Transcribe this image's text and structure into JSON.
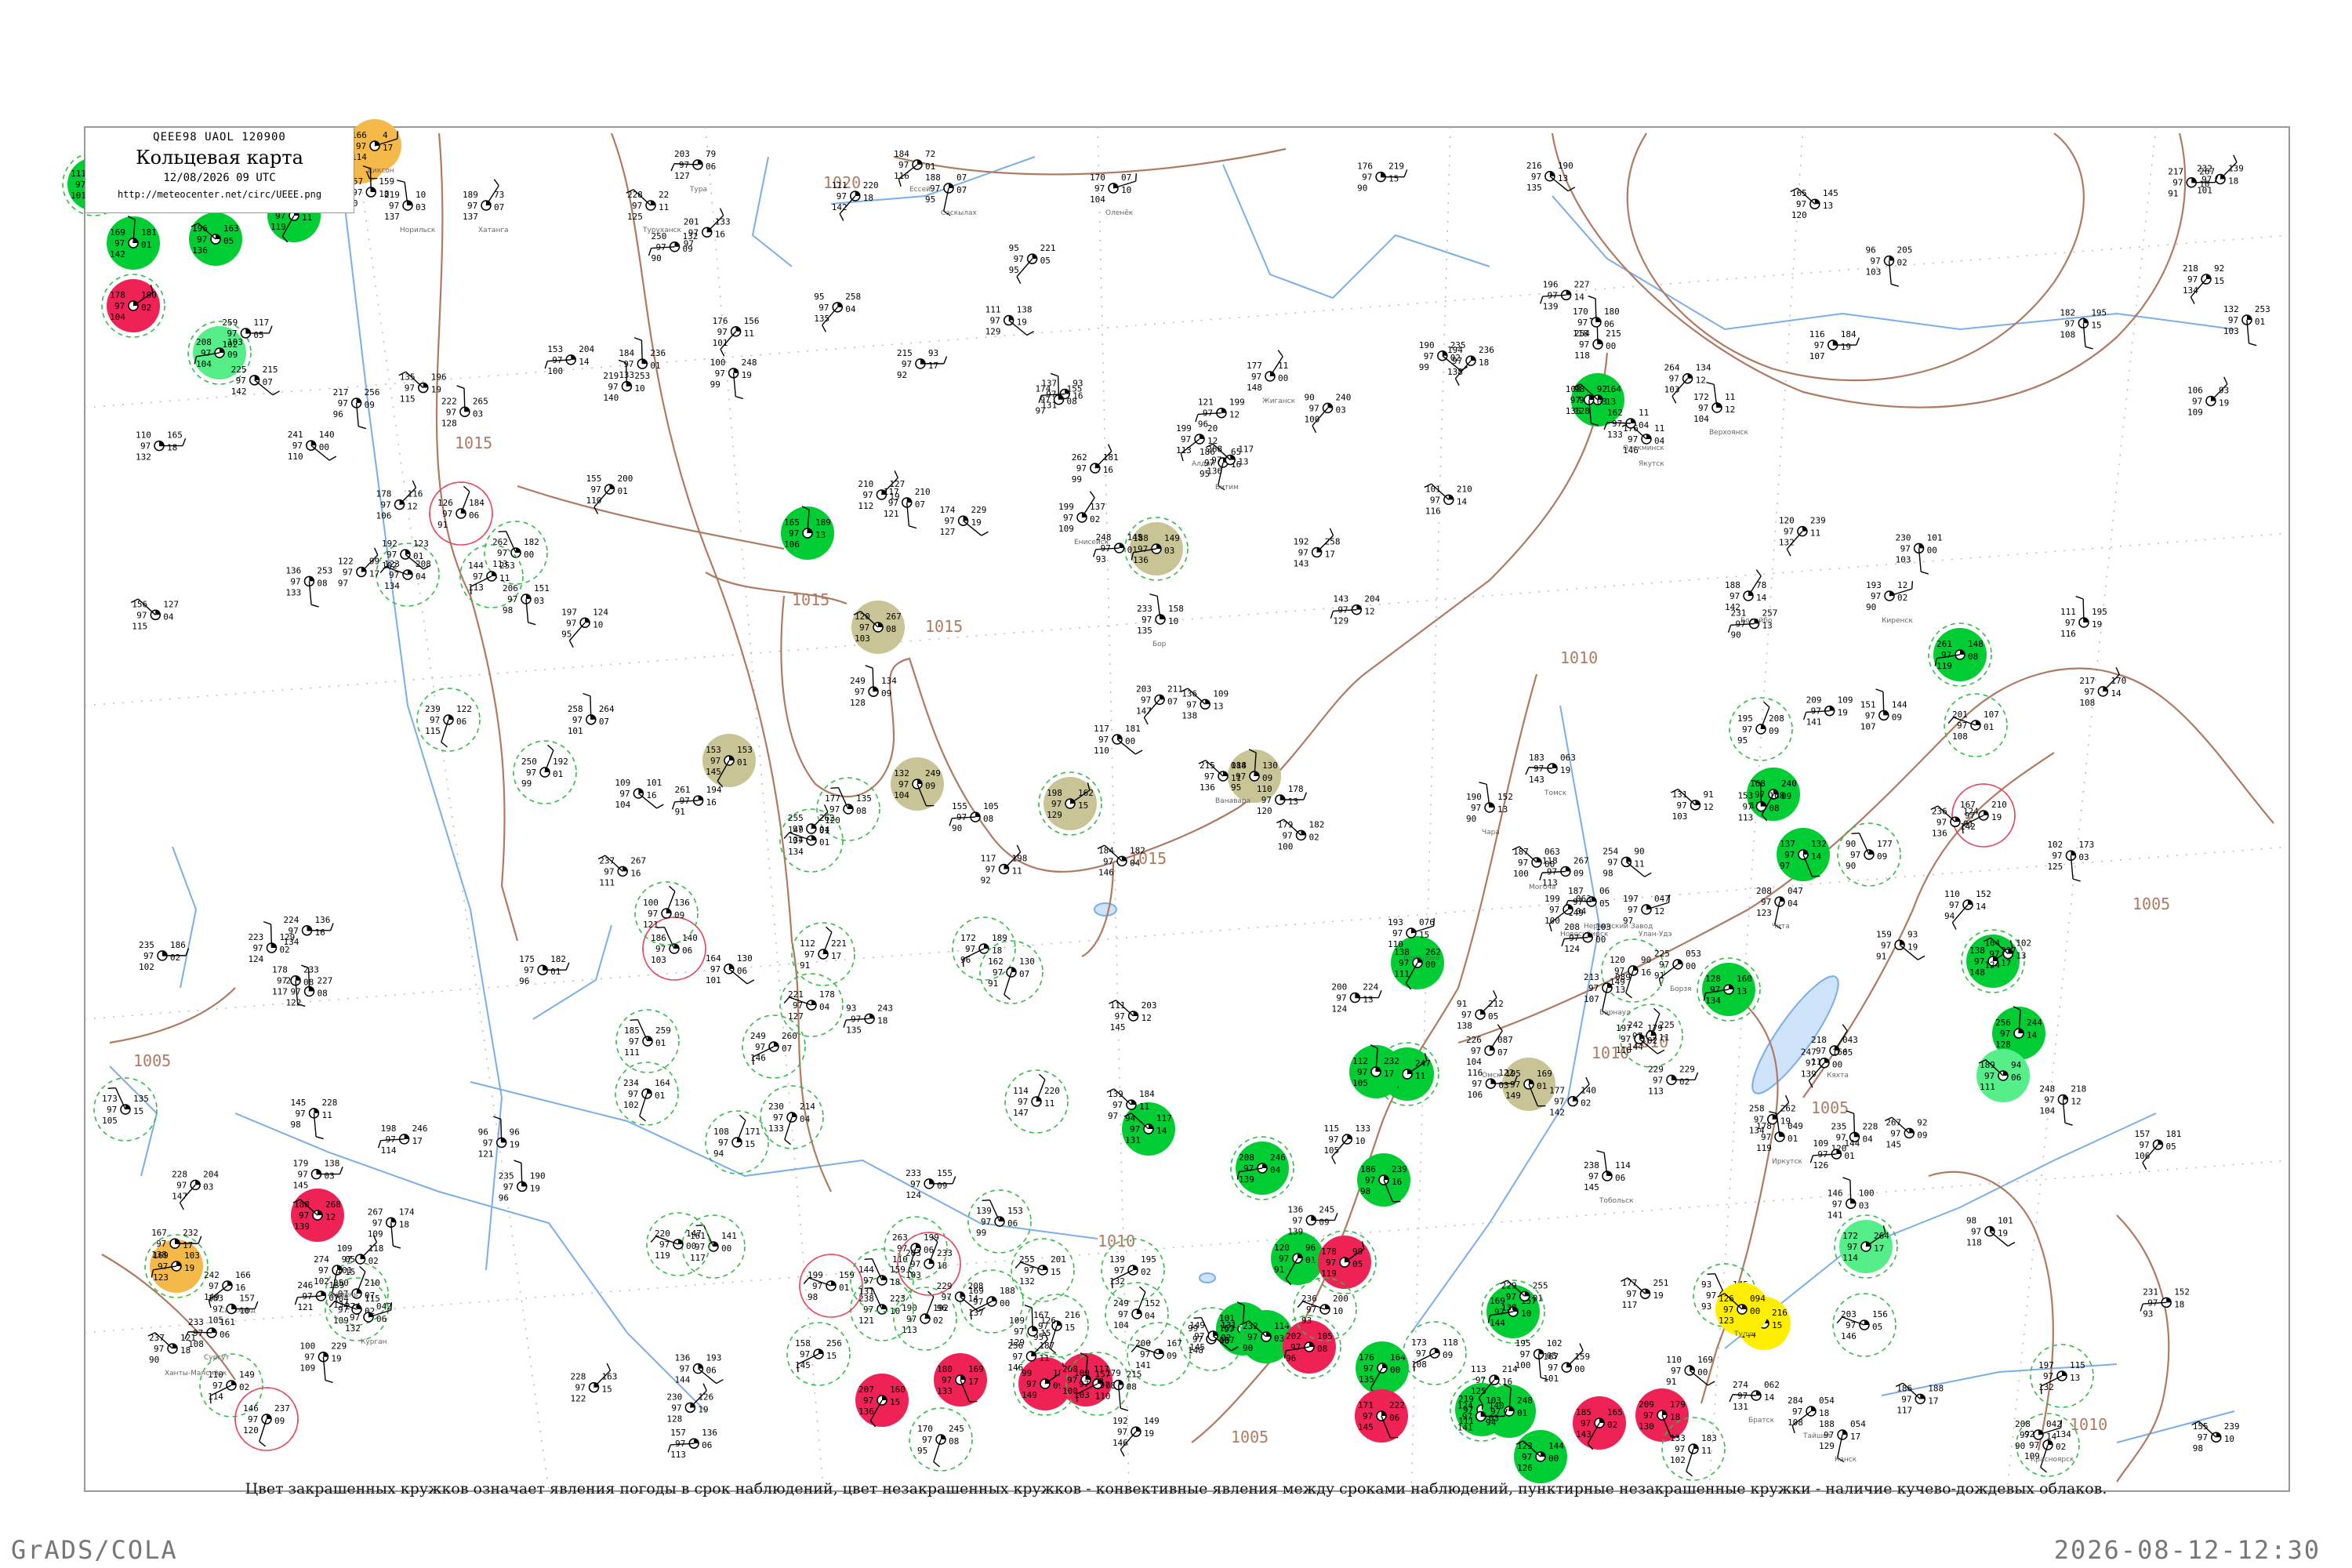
{
  "header": {
    "code": "QEEE98  UAOL  120900",
    "title": "Кольцевая карта",
    "time": "12/08/2026 09 UTC",
    "url": "http://meteocenter.net/circ/UEEE.png"
  },
  "caption": "Цвет закрашенных кружков означает явления погоды в срок наблюдений, цвет незакрашенных кружков - конвективные явления между сроками наблюдений, пунктирные незакрашенные кружки - наличие кучево-дождевых облаков.",
  "footer": {
    "software": "GrADS/COLA",
    "timestamp": "2026-08-12-12:30"
  },
  "colors": {
    "rain": "#00cc33",
    "thunder": "#ee2255",
    "fog": "#c8c496",
    "shower_light": "#55ee88",
    "haze": "#f5b94a",
    "smoke": "#ffee00",
    "isobar": "#b07a60",
    "river": "#7aaee8"
  },
  "isobar_labels": [
    "1020",
    "1015",
    "1015",
    "1015",
    "1015",
    "1010",
    "1010",
    "1010",
    "1010",
    "1005",
    "1005",
    "1005",
    "1005",
    "1010"
  ],
  "stations": [
    {
      "name": "Диксон",
      "p": "166",
      "t": "4",
      "c": "haze"
    },
    {
      "name": "Хатанга",
      "p": "189",
      "t": "73"
    },
    {
      "name": "Норильск",
      "p": "219",
      "t": "10"
    },
    {
      "name": "Туруханск",
      "p": "228",
      "t": "22"
    },
    {
      "name": "Тура",
      "p": "203",
      "t": "79"
    },
    {
      "name": "Ессей",
      "p": "184",
      "t": "72"
    },
    {
      "name": "Саскылах",
      "p": "188",
      "t": "07"
    },
    {
      "name": "Оленёк",
      "p": "170",
      "t": "07"
    },
    {
      "name": "Жиганск",
      "p": "177",
      "t": "11"
    },
    {
      "name": "Верхоянск",
      "p": "172",
      "t": "11"
    },
    {
      "name": "Якутск",
      "p": "176",
      "t": "11"
    },
    {
      "name": "Олекминск",
      "p": "162",
      "t": "11"
    },
    {
      "name": "Алдан",
      "p": "199",
      "t": "20"
    },
    {
      "name": "Витим",
      "p": "186",
      "t": "65"
    },
    {
      "name": "Киренск",
      "p": "193",
      "t": "12"
    },
    {
      "name": "Бодайбо",
      "p": "188",
      "t": "78"
    },
    {
      "name": "Чара",
      "p": "190",
      "t": "152"
    },
    {
      "name": "Могоча",
      "p": "187",
      "t": "063"
    },
    {
      "name": "Нерчинский Завод",
      "p": "187",
      "t": "06"
    },
    {
      "name": "Борзя",
      "p": "225",
      "t": "053"
    },
    {
      "name": "Чита",
      "p": "208",
      "t": "047"
    },
    {
      "name": "Улан-Удэ",
      "p": "197",
      "t": "047"
    },
    {
      "name": "Кяхта",
      "p": "218",
      "t": "043"
    },
    {
      "name": "Иркутск",
      "p": "178",
      "t": "049"
    },
    {
      "name": "Тулун",
      "p": "126",
      "t": "094",
      "c": "smoke"
    },
    {
      "name": "Братск",
      "p": "274",
      "t": "062"
    },
    {
      "name": "Тайшет",
      "p": "284",
      "t": "054"
    },
    {
      "name": "Канск",
      "p": "188",
      "t": "054"
    },
    {
      "name": "Красноярск",
      "p": "208",
      "t": "042"
    },
    {
      "name": "Енисейск",
      "p": "199",
      "t": "137"
    },
    {
      "name": "Бор",
      "p": "233",
      "t": "158"
    },
    {
      "name": "Ванавара",
      "p": "215",
      "t": "088"
    },
    {
      "name": "Томск",
      "p": "183",
      "t": "063"
    },
    {
      "name": "Новосибирск",
      "p": "199",
      "t": "063"
    },
    {
      "name": "Барнаул",
      "p": "213",
      "t": "089"
    },
    {
      "name": "Кемерово",
      "p": "193",
      "t": "076"
    },
    {
      "name": "Омск",
      "p": "226",
      "t": "087"
    },
    {
      "name": "Тобольск",
      "p": "238",
      "t": "114"
    },
    {
      "name": "Ханты-Мансийск",
      "p": "237",
      "t": "121"
    },
    {
      "name": "Сургут",
      "p": "233",
      "t": "161"
    },
    {
      "name": "Салехард",
      "p": "242",
      "t": "166"
    },
    {
      "name": "Тюмень",
      "p": "274",
      "t": "051"
    },
    {
      "name": "Курган",
      "p": "274",
      "t": "042"
    }
  ]
}
